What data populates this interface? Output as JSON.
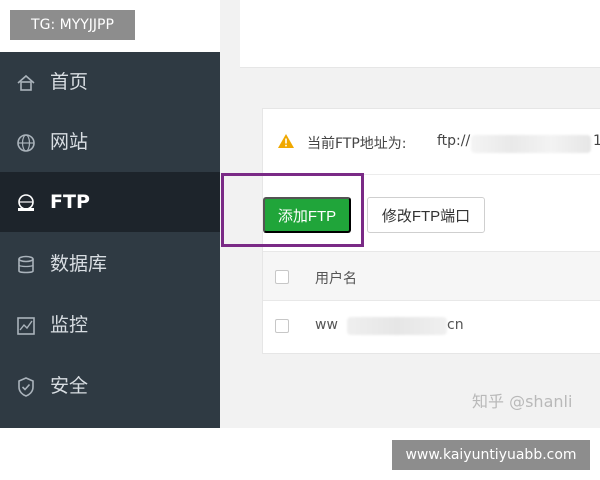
{
  "overlay": {
    "tg": "TG: MYYJJPP",
    "url": "www.kaiyuntiyuabb.com"
  },
  "sidebar": {
    "items": [
      {
        "label": "首页",
        "icon": "home-icon"
      },
      {
        "label": "网站",
        "icon": "globe-icon"
      },
      {
        "label": "FTP",
        "icon": "ftp-icon",
        "active": true
      },
      {
        "label": "数据库",
        "icon": "database-icon"
      },
      {
        "label": "监控",
        "icon": "monitor-icon"
      },
      {
        "label": "安全",
        "icon": "shield-icon"
      }
    ]
  },
  "notice": {
    "label": "当前FTP地址为:",
    "value_prefix": "ftp://",
    "value_tail": "1"
  },
  "toolbar": {
    "add_label": "添加FTP",
    "port_label": "修改FTP端口"
  },
  "table": {
    "header_user": "用户名",
    "rows": [
      {
        "user_prefix": "ww",
        "user_suffix": "cn"
      }
    ]
  },
  "watermark": "知乎 @shanli",
  "colors": {
    "sidebar_bg": "#2f3a43",
    "sidebar_active_bg": "#1d242b",
    "primary_green": "#20a53a",
    "highlight_box": "#7a2a86",
    "warning": "#f0a800"
  }
}
